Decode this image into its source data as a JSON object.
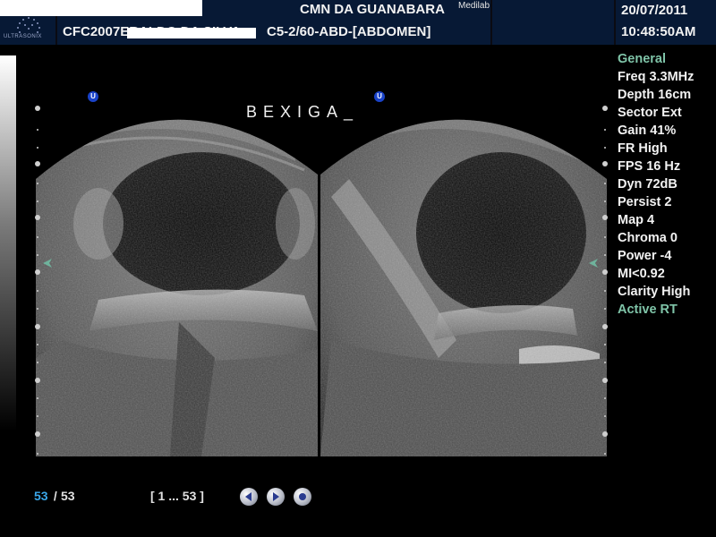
{
  "header": {
    "facility": "CMN DA GUANABARA",
    "brand": "Medilab",
    "logo_text": "ULTRASONIX",
    "patient_id": "CFC2007ERALDO DA SILVA",
    "probe_preset": "C5-2/60-ABD-[ABDOMEN]",
    "date": "20/07/2011",
    "time": "10:48:50AM"
  },
  "image": {
    "annotation": "BEXIGA_",
    "probe_marker_left": "U",
    "probe_marker_right": "U"
  },
  "params": {
    "title": "General",
    "items": [
      "Freq 3.3MHz",
      "Depth 16cm",
      "Sector Ext",
      "Gain 41%",
      "FR High",
      "FPS 16 Hz",
      "Dyn 72dB",
      "Persist 2",
      "Map 4",
      "Chroma 0",
      "Power -4",
      "MI<0.92",
      "Clarity High"
    ],
    "status": "Active RT"
  },
  "cine": {
    "current": "53",
    "total": "53",
    "range": "[ 1 ... 53 ]"
  },
  "colors": {
    "header_bg": "#071935",
    "param_green": "#7fc4a8",
    "cine_current": "#3aa6e8",
    "probe_marker": "#1a43c9"
  },
  "icons": [
    "previous-frame-icon",
    "play-icon",
    "stop-icon",
    "orientation-marker-icon"
  ]
}
